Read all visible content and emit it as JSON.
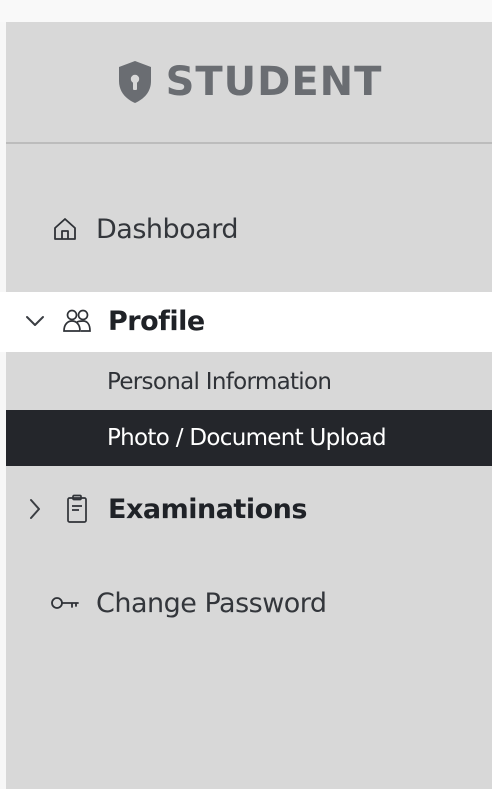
{
  "brand": {
    "title": "STUDENT",
    "icon": "shield-icon",
    "color": "#6a6d72"
  },
  "nav": {
    "dashboard": {
      "label": "Dashboard",
      "icon": "home-icon"
    },
    "profile": {
      "label": "Profile",
      "icon": "users-icon",
      "expanded": true,
      "children": [
        {
          "label": "Personal Information"
        },
        {
          "label": "Photo / Document Upload",
          "selected": true
        }
      ]
    },
    "examinations": {
      "label": "Examinations",
      "icon": "clipboard-icon",
      "expanded": false
    },
    "change_password": {
      "label": "Change Password",
      "icon": "key-icon"
    }
  },
  "colors": {
    "panel_bg": "#d8d8d8",
    "active_parent_bg": "#ffffff",
    "selected_bg": "#24262b",
    "selected_text": "#ffffff"
  }
}
